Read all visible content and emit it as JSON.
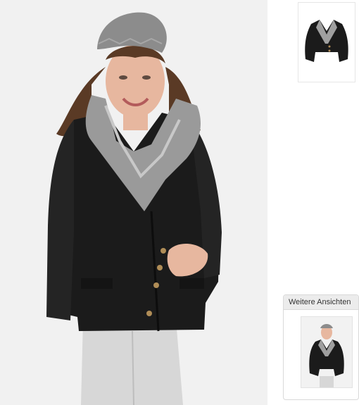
{
  "product_viewer": {
    "main_image": {
      "subject": "woman-in-black-shearling-jacket"
    },
    "thumbnails": [
      {
        "kind": "product-only"
      }
    ],
    "more_views": {
      "title": "Weitere Ansichten",
      "items": [
        {
          "kind": "model-view"
        }
      ]
    }
  },
  "colors": {
    "jacket": "#1b1b1b",
    "fur": "#9a9a9a",
    "beanie": "#8c8c8c",
    "hair": "#5a3a25",
    "skin": "#e7b79f",
    "jeans": "#d7d7d7",
    "background": "#f2f2f2",
    "panel_border": "#d9d9d9"
  }
}
